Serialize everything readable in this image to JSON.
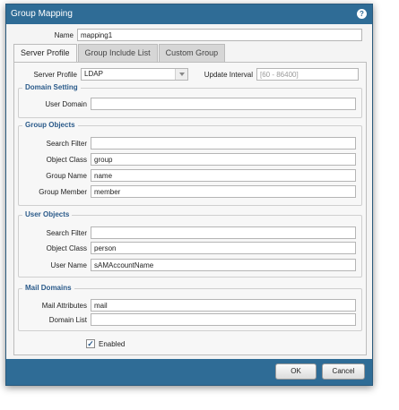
{
  "dialog": {
    "title": "Group Mapping",
    "help_glyph": "?",
    "name_label": "Name",
    "name_value": "mapping1"
  },
  "tabs": [
    {
      "label": "Server Profile",
      "active": true
    },
    {
      "label": "Group Include List",
      "active": false
    },
    {
      "label": "Custom Group",
      "active": false
    }
  ],
  "server_profile": {
    "label": "Server Profile",
    "value": "LDAP",
    "update_interval_label": "Update Interval",
    "update_interval_placeholder": "[60 - 86400]"
  },
  "domain_setting": {
    "title": "Domain Setting",
    "user_domain_label": "User Domain",
    "user_domain_value": ""
  },
  "group_objects": {
    "title": "Group Objects",
    "search_filter_label": "Search Filter",
    "search_filter_value": "",
    "object_class_label": "Object Class",
    "object_class_value": "group",
    "group_name_label": "Group Name",
    "group_name_value": "name",
    "group_member_label": "Group Member",
    "group_member_value": "member"
  },
  "user_objects": {
    "title": "User Objects",
    "search_filter_label": "Search Filter",
    "search_filter_value": "",
    "object_class_label": "Object Class",
    "object_class_value": "person",
    "user_name_label": "User Name",
    "user_name_value": "sAMAccountName"
  },
  "mail_domains": {
    "title": "Mail Domains",
    "mail_attributes_label": "Mail Attributes",
    "mail_attributes_value": "mail",
    "domain_list_label": "Domain List",
    "domain_list_value": ""
  },
  "enabled": {
    "label": "Enabled",
    "checked": true,
    "check_glyph": "✓"
  },
  "footer": {
    "ok_label": "OK",
    "cancel_label": "Cancel"
  },
  "colors": {
    "titlebar": "#2f6c96",
    "group_title": "#2a5a8a"
  }
}
